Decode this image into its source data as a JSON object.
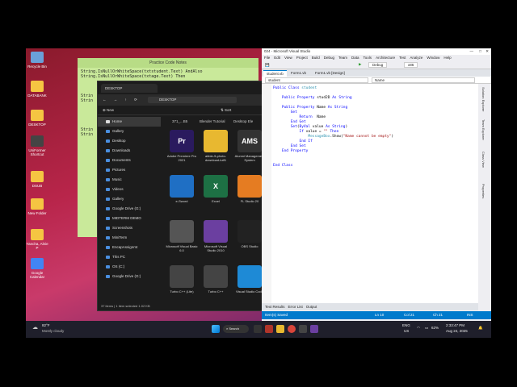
{
  "desktop": {
    "icons": [
      {
        "label": "Recycle Bin",
        "color": "#6aa0d8"
      },
      {
        "label": "DATABANK",
        "color": "#f5c542"
      },
      {
        "label": "DESKTOP",
        "color": "#f5c542"
      },
      {
        "label": "UniFormer Shortcut",
        "color": "#444444"
      },
      {
        "label": "DSUB",
        "color": "#f5c542"
      },
      {
        "label": "New Folder",
        "color": "#f5c542"
      },
      {
        "label": "Yancha, Alnie P",
        "color": "#f5c542"
      },
      {
        "label": "Google Calendar",
        "color": "#4285f4"
      }
    ]
  },
  "sticky_note": {
    "title": "Practice Code Notes",
    "lines": [
      "String.IsNullOrWhiteSpace(txtstudent.Text) AndAlso",
      "String.IsNullOrWhiteSpace(txtage.Text) Then",
      "",
      "",
      "",
      "Strin",
      "Strin",
      "",
      "",
      "",
      "",
      "",
      "Strin",
      "Strin"
    ]
  },
  "explorer": {
    "tab_title": "DESKTOP",
    "address": "DESKTOP",
    "new_label": "New",
    "sort_label": "Sort",
    "column_headers": [
      "371_...B5",
      "Blender Tutorial",
      "Desktop Ele"
    ],
    "sidebar": [
      "Home",
      "Gallery",
      "Desktop",
      "Downloads",
      "Documents",
      "Pictures",
      "Music",
      "Videos",
      "Gallery",
      "Google Drive (G:)",
      "MIDTERM DEMO",
      "Screenshots",
      "MiniTerm",
      "EncapAssignmt",
      "This PC",
      "OS (C:)",
      "Google Drive (G:)"
    ],
    "tiles": [
      {
        "label": "Adobe Premiere Pro 2021",
        "color": "#2a1a5e",
        "glyph": "Pr"
      },
      {
        "label": "abbie-5-photo-download-tutf1",
        "color": "#e8b830",
        "glyph": ""
      },
      {
        "label": "Alumni Management System",
        "color": "#333333",
        "glyph": "AMS"
      },
      {
        "label": "e-Sword",
        "color": "#1f6fc4",
        "glyph": ""
      },
      {
        "label": "Excel",
        "color": "#1d7044",
        "glyph": "X"
      },
      {
        "label": "FL Studio 20",
        "color": "#e57c22",
        "glyph": ""
      },
      {
        "label": "Microsoft Visual Basic 6.0",
        "color": "#555555",
        "glyph": ""
      },
      {
        "label": "Microsoft Visual Studio 2010",
        "color": "#6b3fa0",
        "glyph": ""
      },
      {
        "label": "OBS Studio",
        "color": "#222222",
        "glyph": ""
      },
      {
        "label": "Turbo C++ (Lite)",
        "color": "#444444",
        "glyph": ""
      },
      {
        "label": "Turbo C++",
        "color": "#444444",
        "glyph": ""
      },
      {
        "label": "Visual Studio Code",
        "color": "#1e8ad6",
        "glyph": ""
      }
    ],
    "status": "37 items  |  1 item selected  1.02 KB"
  },
  "vs": {
    "title": "024 - Microsoft Visual Studio",
    "menu": [
      "File",
      "Edit",
      "View",
      "Project",
      "Build",
      "Debug",
      "Team",
      "Data",
      "Tools",
      "Architecture",
      "Test",
      "Analyze",
      "Window",
      "Help"
    ],
    "config": "Debug",
    "platform": "x86",
    "tabs": [
      "student.vb",
      "Form1.vb",
      "Form1.vb [Design]"
    ],
    "combo_left": "student",
    "combo_right": "Name",
    "code": [
      "Public Class student",
      "",
      "    Public Property stud2D As String",
      "",
      "    Public Property Name As String",
      "        Get",
      "            Return  Name",
      "        End Get",
      "        Set(ByVal value As String)",
      "            If value = \"\" Then",
      "                MessageBox.Show(\"Name cannot be empty\")",
      "            End If",
      "        End Set",
      "    End Property",
      "",
      "",
      "End Class"
    ],
    "right_panels": [
      "Solution Explorer",
      "Team Explorer",
      "Class View",
      "Properties"
    ],
    "bottom_tabs": [
      "Text Results",
      "Error List",
      "Output"
    ],
    "status_left": "Item(s) Saved",
    "status_ln": "Ln 10",
    "status_col": "Col 21",
    "status_ch": "Ch 21",
    "status_mode": "INS"
  },
  "taskbar": {
    "weather_temp": "82°F",
    "weather_desc": "Mostly cloudy",
    "search": "Search",
    "lang": "ENG",
    "region": "US",
    "battery": "62%",
    "time": "2:33:47 PM",
    "date": "Aug 24, 2025"
  }
}
